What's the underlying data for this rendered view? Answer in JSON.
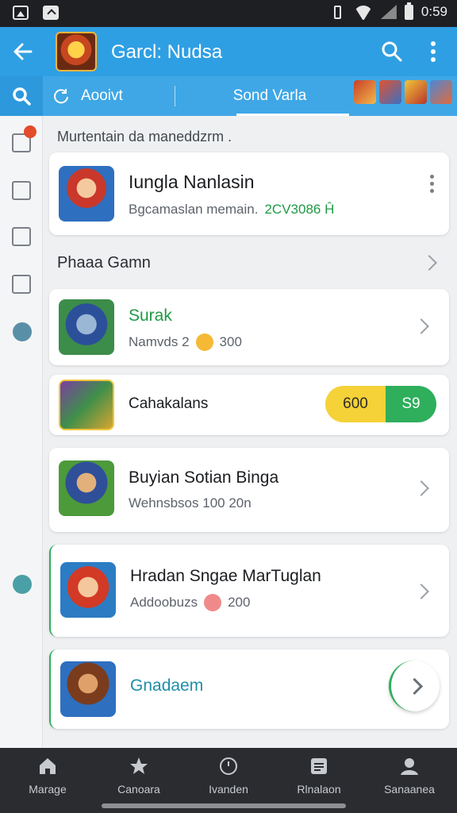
{
  "status_bar": {
    "time": "0:59"
  },
  "app_bar": {
    "title": "Garcl: Nudsa"
  },
  "tabs": [
    {
      "label": "Aooivt"
    },
    {
      "label": "Sond Varla"
    }
  ],
  "section_note": "Murtentain da maneddzrm .",
  "featured": {
    "title": "Iungla Nanlasin",
    "subtitle": "Bgcamaslan memain.",
    "code": "2CV3086 Ĥ"
  },
  "section_heading": "Phaaa Gamn",
  "games": [
    {
      "title": "Surak",
      "meta": "Namvds 2",
      "count": "300"
    },
    {
      "title": "Cahakalans",
      "toggle_left": "600",
      "toggle_right": "S9"
    },
    {
      "title": "Buyian Sotian Binga",
      "meta": "Wehnsbsos 100 20n"
    },
    {
      "title": "Hradan Sngae MarTuglan",
      "meta": "Addoobuzs",
      "count": "200"
    },
    {
      "title": "Gnadaem"
    }
  ],
  "bottom_nav": [
    {
      "label": "Marage"
    },
    {
      "label": "Canoara"
    },
    {
      "label": "Ivanden"
    },
    {
      "label": "Rlnalaon"
    },
    {
      "label": "Sanaanea"
    }
  ],
  "colors": {
    "app_bar": "#2f9fe3",
    "tab_bar": "#3fa7e6",
    "accent_green": "#2fae5c",
    "accent_yellow": "#f5d237",
    "bottom_nav": "#2a2c30"
  }
}
